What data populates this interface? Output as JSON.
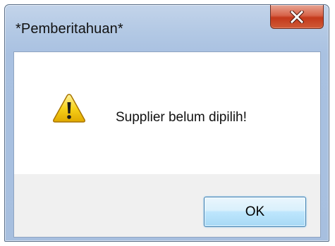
{
  "window": {
    "title": "*Pemberitahuan*",
    "close_icon": "close-x-icon"
  },
  "dialog": {
    "icon": "warning-icon",
    "message": "Supplier belum dipilih!",
    "ok_label": "OK"
  },
  "colors": {
    "close_button": "#c4391b",
    "ok_button_border": "#3c7fb1",
    "warning_fill": "#f5c400"
  }
}
